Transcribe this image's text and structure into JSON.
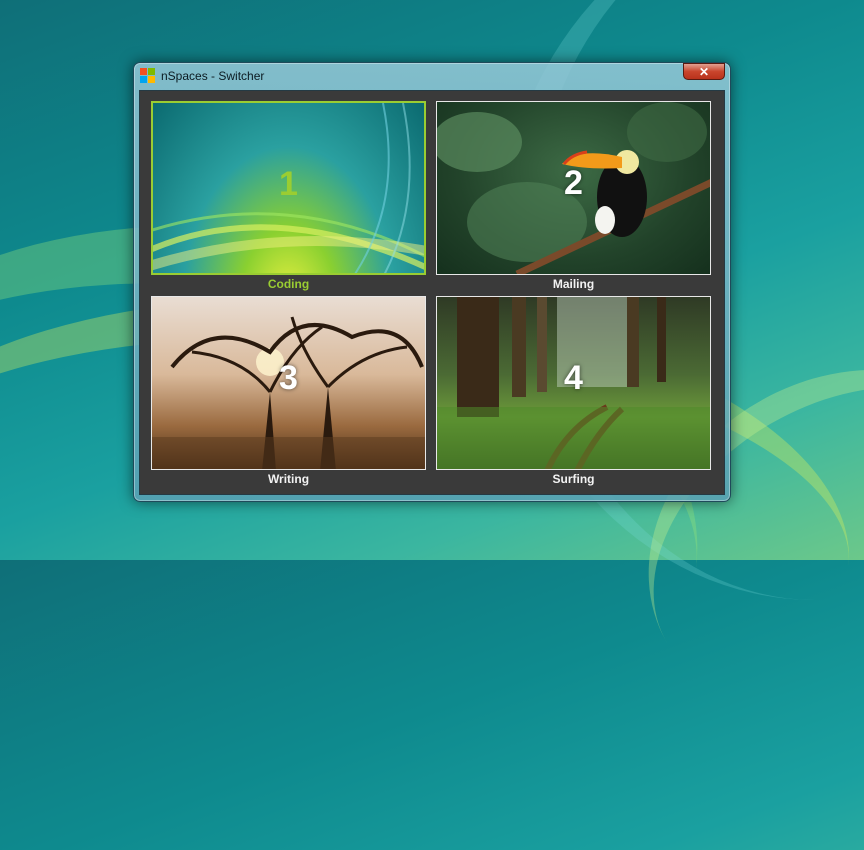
{
  "window": {
    "title": "nSpaces - Switcher",
    "close_label": "✕"
  },
  "spaces": [
    {
      "number": "1",
      "name": "Coding",
      "active": true
    },
    {
      "number": "2",
      "name": "Mailing",
      "active": false
    },
    {
      "number": "3",
      "name": "Writing",
      "active": false
    },
    {
      "number": "4",
      "name": "Surfing",
      "active": false
    }
  ],
  "colors": {
    "active_accent": "#9acd32",
    "content_background": "#3a3a3a",
    "close_button": "#c9452c"
  },
  "icons": {
    "app": "windows-flag-icon",
    "close": "close-icon"
  }
}
